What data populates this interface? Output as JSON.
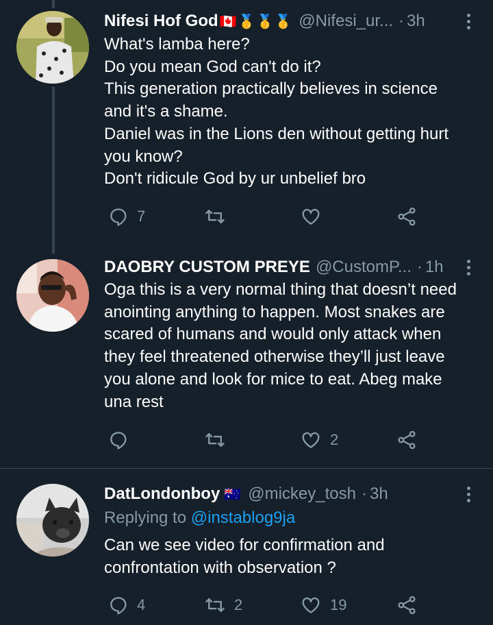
{
  "tweets": [
    {
      "name": "Nifesi Hof God",
      "badges": "🇨🇦🥇🥇🥇",
      "handle": "@Nifesi_ur...",
      "dot": "·",
      "time": "3h",
      "lines": [
        "What's lamba here?",
        "Do you mean God can't do it?",
        "This generation practically believes in science",
        "and it's a shame.",
        "Daniel was in the Lions den without getting hurt",
        "you know?",
        "Don't ridicule God by ur unbelief bro"
      ],
      "reply_count": "7",
      "retweet_count": "",
      "like_count": ""
    },
    {
      "name": "DAOBRY CUSTOM PREYE",
      "badges": "",
      "handle": "@CustomP...",
      "dot": "·",
      "time": "1h",
      "lines": [
        "Oga this is a very normal thing that doesn’t need",
        "anointing anything to happen. Most snakes are",
        "scared of humans and would only attack when",
        "they feel threatened otherwise they’ll just leave",
        "you alone and look for mice to eat. Abeg make",
        "una rest"
      ],
      "reply_count": "",
      "retweet_count": "",
      "like_count": "2"
    },
    {
      "name": "DatLondonboy",
      "badges": "🇦🇺",
      "handle": "@mickey_tosh",
      "dot": "·",
      "time": "3h",
      "replying_prefix": "Replying to",
      "replying_to": "@instablog9ja",
      "lines": [
        "Can we see video for confirmation and",
        "confrontation with observation ?"
      ],
      "reply_count": "4",
      "retweet_count": "2",
      "like_count": "19"
    }
  ],
  "icons": {
    "reply": "reply-icon",
    "retweet": "retweet-icon",
    "like": "heart-icon",
    "share": "share-icon",
    "more": "more-icon"
  },
  "colors": {
    "background": "#15202b",
    "text": "#ffffff",
    "secondary": "#8899a6",
    "link": "#1da1f2",
    "divider": "#38444d"
  }
}
